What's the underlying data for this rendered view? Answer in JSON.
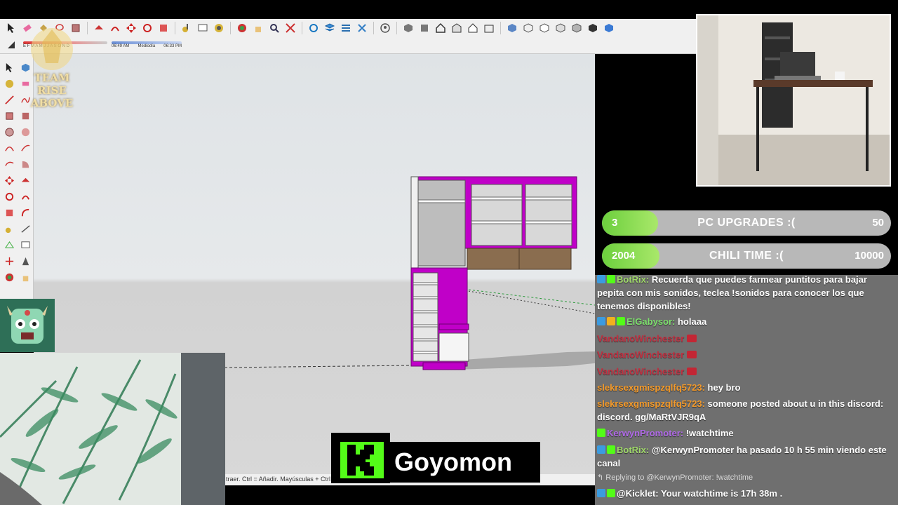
{
  "toolbar": {
    "months_label": "E F M A M J J A S O N D",
    "time_start": "06:49 AM",
    "time_mid": "Mediodía",
    "time_end": "06:33 PM"
  },
  "statusbar": {
    "hint": "traer. Ctrl = Añadir. Mayúsculas + Ctrl ="
  },
  "logo": {
    "text": "TEAM RISE ABOVE"
  },
  "goals": [
    {
      "count": "3",
      "title": "PC UPGRADES :(",
      "target": "50",
      "progress": 0.06
    },
    {
      "count": "2004",
      "title": "CHILI TIME :(",
      "target": "10000",
      "progress": 0.2
    }
  ],
  "chat": {
    "messages": [
      {
        "user": "BotRix:",
        "text": "Recuerda que puedes farmear puntitos para bajar pepita con mis sonidos, teclea !sonidos para conocer los que tenemos disponibles!",
        "color": "#9fd86a"
      },
      {
        "user": "ElGabysor:",
        "text": "holaaa",
        "color": "#7ee06e"
      },
      {
        "user": "VandanoWinchester",
        "text": "",
        "color": "#d0263a"
      },
      {
        "user": "VandanoWinchester",
        "text": "",
        "color": "#d0263a"
      },
      {
        "user": "VandanoWinchester",
        "text": "",
        "color": "#d0263a"
      },
      {
        "user": "slekrsexgmispzqlfq5723:",
        "text": "hey bro",
        "color": "#f39a2b"
      },
      {
        "user": "slekrsexgmispzqlfq5723:",
        "text": "someone posted about u in this discord: discord. gg/MaRtVJR9qA",
        "color": "#f39a2b"
      },
      {
        "user": "KerwynPromoter:",
        "text": "!watchtime",
        "color": "#b06ae8"
      },
      {
        "user": "BotRix:",
        "text": "@KerwynPromoter ha pasado 10 h 55 min viendo este canal",
        "color": "#9fd86a"
      },
      {
        "user": "@Kicklet:",
        "text": "Your watchtime is 17h 38m .",
        "color": "#ffffff"
      }
    ],
    "reply_label": "Replying to @KerwynPromoter: !watchtime"
  },
  "kick": {
    "channel": "Goyomon"
  },
  "colors": {
    "magenta": "#c000c8",
    "kick_green": "#53fc18",
    "goal_green": "#6ccf3d"
  }
}
